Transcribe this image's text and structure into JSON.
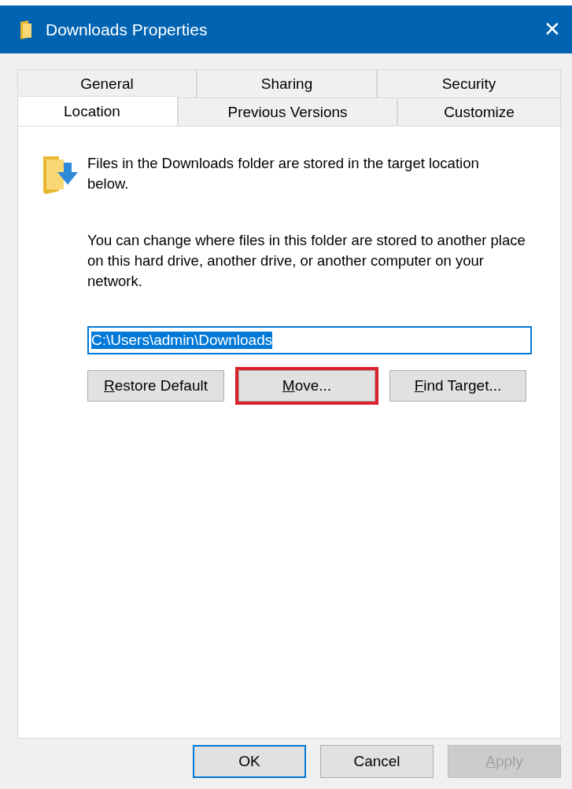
{
  "window": {
    "title": "Downloads Properties",
    "close": "✕"
  },
  "tabs": [
    [
      {
        "label": "General",
        "selected": false
      },
      {
        "label": "Sharing",
        "selected": false
      },
      {
        "label": "Security",
        "selected": false
      }
    ],
    [
      {
        "label": "Location",
        "selected": true
      },
      {
        "label": "Previous Versions",
        "selected": false
      },
      {
        "label": "Customize",
        "selected": false
      }
    ]
  ],
  "info": "Files in the Downloads folder are stored in the target location below.",
  "description": "You can change where files in this folder are stored to another place on this hard drive, another drive, or another computer on your network.",
  "path_field": {
    "value": "C:\\Users\\admin\\Downloads",
    "selected_text": true
  },
  "location_buttons": [
    {
      "label": "Restore Default",
      "underline_first": true,
      "highlighted": false
    },
    {
      "label": "Move...",
      "underline_first": true,
      "highlighted": true
    },
    {
      "label": "Find Target...",
      "underline_first": true,
      "highlighted": false
    }
  ],
  "dialog_buttons": [
    {
      "label": "OK",
      "default": true,
      "disabled": false,
      "underline_first": false
    },
    {
      "label": "Cancel",
      "default": false,
      "disabled": false,
      "underline_first": false
    },
    {
      "label": "Apply",
      "default": false,
      "disabled": true,
      "underline_first": true
    }
  ]
}
